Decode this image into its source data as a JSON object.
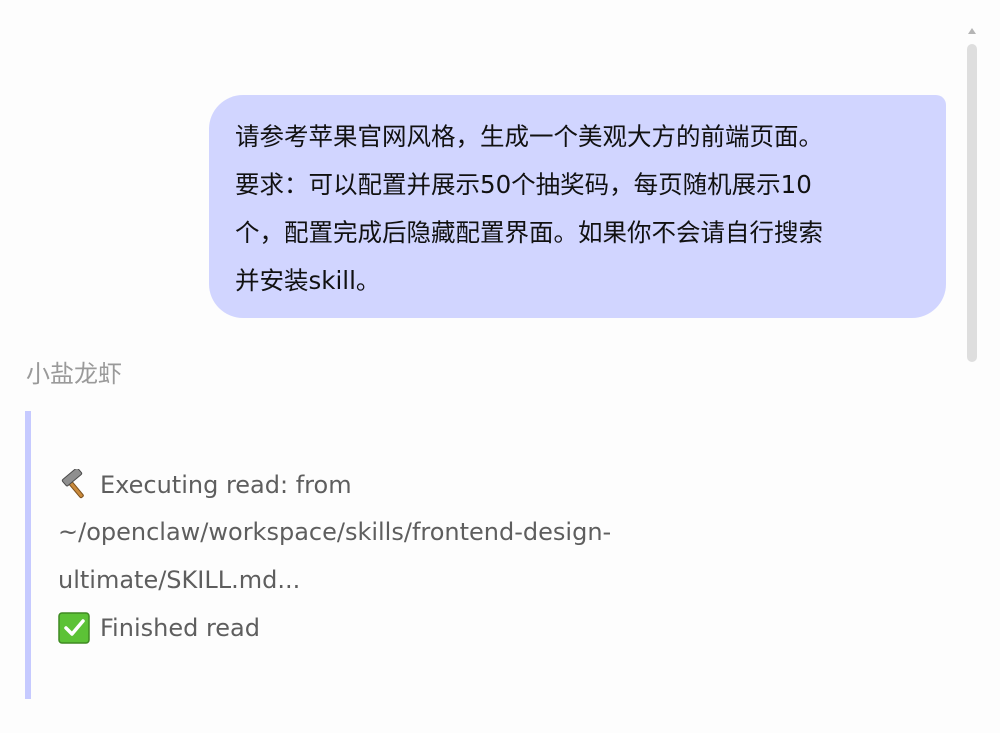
{
  "user_message": {
    "text": "请参考苹果官网风格，生成一个美观大方的前端页面。\n要求：可以配置并展示50个抽奖码，每页随机展示10\n个，配置完成后隐藏配置界面。如果你不会请自行搜索\n并安装skill。"
  },
  "assistant": {
    "name": "小盐龙虾",
    "tool_log": {
      "executing_label": "Executing read: from",
      "path_line1": "~/openclaw/workspace/skills/frontend-design-",
      "path_line2": "ultimate/SKILL.md...",
      "finished_label": "Finished read"
    }
  },
  "icons": {
    "executing": "hammer-icon",
    "finished": "check-mark-icon"
  },
  "colors": {
    "user_bubble": "#d1d5ff",
    "accent_border": "#c6caff",
    "sender_name": "#9a9a9a",
    "log_text": "#5e5e5e",
    "check_green": "#5cc236"
  }
}
